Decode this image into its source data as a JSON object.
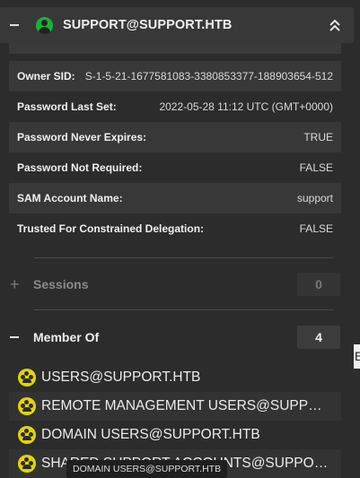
{
  "header": {
    "title": "SUPPORT@SUPPORT.HTB"
  },
  "properties": [
    {
      "key": "Owner SID:",
      "value": "S-1-5-21-1677581083-3380853377-188903654-512"
    },
    {
      "key": "Password Last Set:",
      "value": "2022-05-28 11:12 UTC (GMT+0000)"
    },
    {
      "key": "Password Never Expires:",
      "value": "TRUE"
    },
    {
      "key": "Password Not Required:",
      "value": "FALSE"
    },
    {
      "key": "SAM Account Name:",
      "value": "support"
    },
    {
      "key": "Trusted For Constrained Delegation:",
      "value": "FALSE"
    }
  ],
  "sessions": {
    "label": "Sessions",
    "count": "0"
  },
  "member_of": {
    "label": "Member Of",
    "count": "4",
    "groups": [
      "USERS@SUPPORT.HTB",
      "REMOTE MANAGEMENT USERS@SUPPORT.HTB",
      "DOMAIN USERS@SUPPORT.HTB",
      "SHARED SUPPORT ACCOUNTS@SUPPORT.HTB"
    ]
  },
  "tooltip": "DOMAIN USERS@SUPPORT.HTB",
  "edge_text": "E",
  "colors": {
    "user_icon": "#18b23a",
    "group_icon": "#e3d400",
    "panel": "#2c2c2c"
  }
}
